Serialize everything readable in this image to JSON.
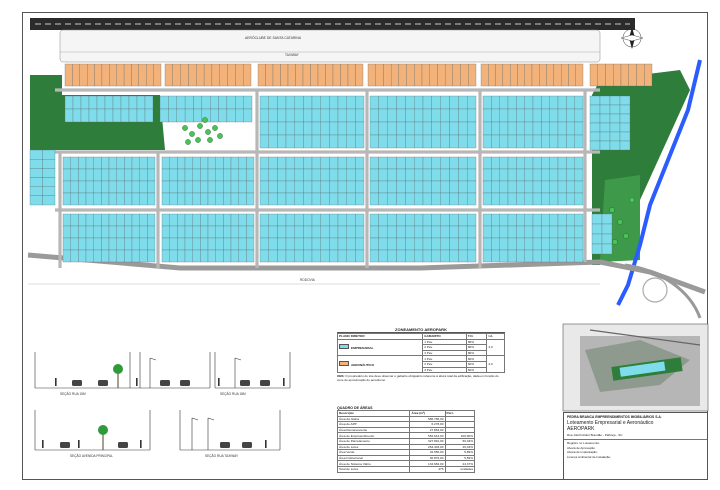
{
  "airfield": {
    "name": "AERÓCLUBE DE SANTA CATARINA",
    "taxiway_label": "TAXIWAY",
    "road_label": "RODOVIA"
  },
  "zoning": {
    "title": "ZONEAMENTO AEROPARK",
    "headers": [
      "PLANO DIRETOR",
      "GABARITO",
      "T.O.",
      "I.A."
    ],
    "rows": [
      {
        "zone": "EMPRESARIAL",
        "gabarito": [
          "1 Pav.",
          "2 Pav.",
          "3 Pav."
        ],
        "to": [
          "80%",
          "80%",
          "80%"
        ],
        "ia": "2,0",
        "color": "#7fdcea"
      },
      {
        "zone": "AERONÁUTICO",
        "gabarito": [
          "1 Pav.",
          "2 Pav.",
          "3 Pav."
        ],
        "to": [
          "60%",
          "60%",
          "60%"
        ],
        "ia": "2,0",
        "color": "#f2b27a"
      }
    ],
    "obs_label": "OBS:",
    "obs_text": "O proprietário do lote deve observar o gabarito obrigatório referente à altura total da edificação, dada em função do cone de aproximação do aeródromo."
  },
  "areas": {
    "title": "QUADRO DE ÁREAS",
    "headers": [
      "Descrição",
      "Área (m²)",
      "Perc."
    ],
    "rows": [
      [
        "Área da Gleba",
        "586.786,00",
        ""
      ],
      [
        "Área de APP",
        "6.278,00",
        ""
      ],
      [
        "Área Remanescente",
        "27.864,00",
        ""
      ],
      [
        "Área de Empreendimento",
        "552.644,00",
        "100,00%"
      ],
      [
        "Área de Parcelamento",
        "327.891,00",
        "59,33%"
      ],
      [
        "Área de Lotes",
        "254.403,00",
        "46,03%"
      ],
      [
        "Área Verde",
        "32.550,00",
        "5,89%"
      ],
      [
        "Área Institucional",
        "30.876,00",
        "5,59%"
      ],
      [
        "Área de Sistema Viário",
        "134.682,00",
        "24,37%"
      ],
      [
        "Total de Lotes",
        "475",
        "unidades"
      ]
    ]
  },
  "sections": {
    "labels": [
      "SEÇÃO RUA 15M",
      "SEÇÃO RUA 18M",
      "SEÇÃO AVENIDA PRINCIPAL",
      "SEÇÃO RUA TAXIWAY"
    ]
  },
  "title_block": {
    "company": "PEDRA BRANCA EMPREENDIMENTOS IMOBILIÁRIOS S.A.",
    "project": "Loteamento Empresarial e Aeronáutico",
    "project_name": "AEROPARK",
    "location": "Rua Jofeth Aldori Brandão - Palhoça - SC",
    "fields": [
      "Registro no Loteamento:",
      "Alvará de Aprovação:",
      "Alvará de Implantação:",
      "Licença Ambiental de Instalação:"
    ]
  },
  "colors": {
    "aero_lot": "#f2b27a",
    "business_lot": "#7fdcea",
    "green_area": "#2f7d3a",
    "river": "#2a5cff",
    "runway": "#222222"
  }
}
